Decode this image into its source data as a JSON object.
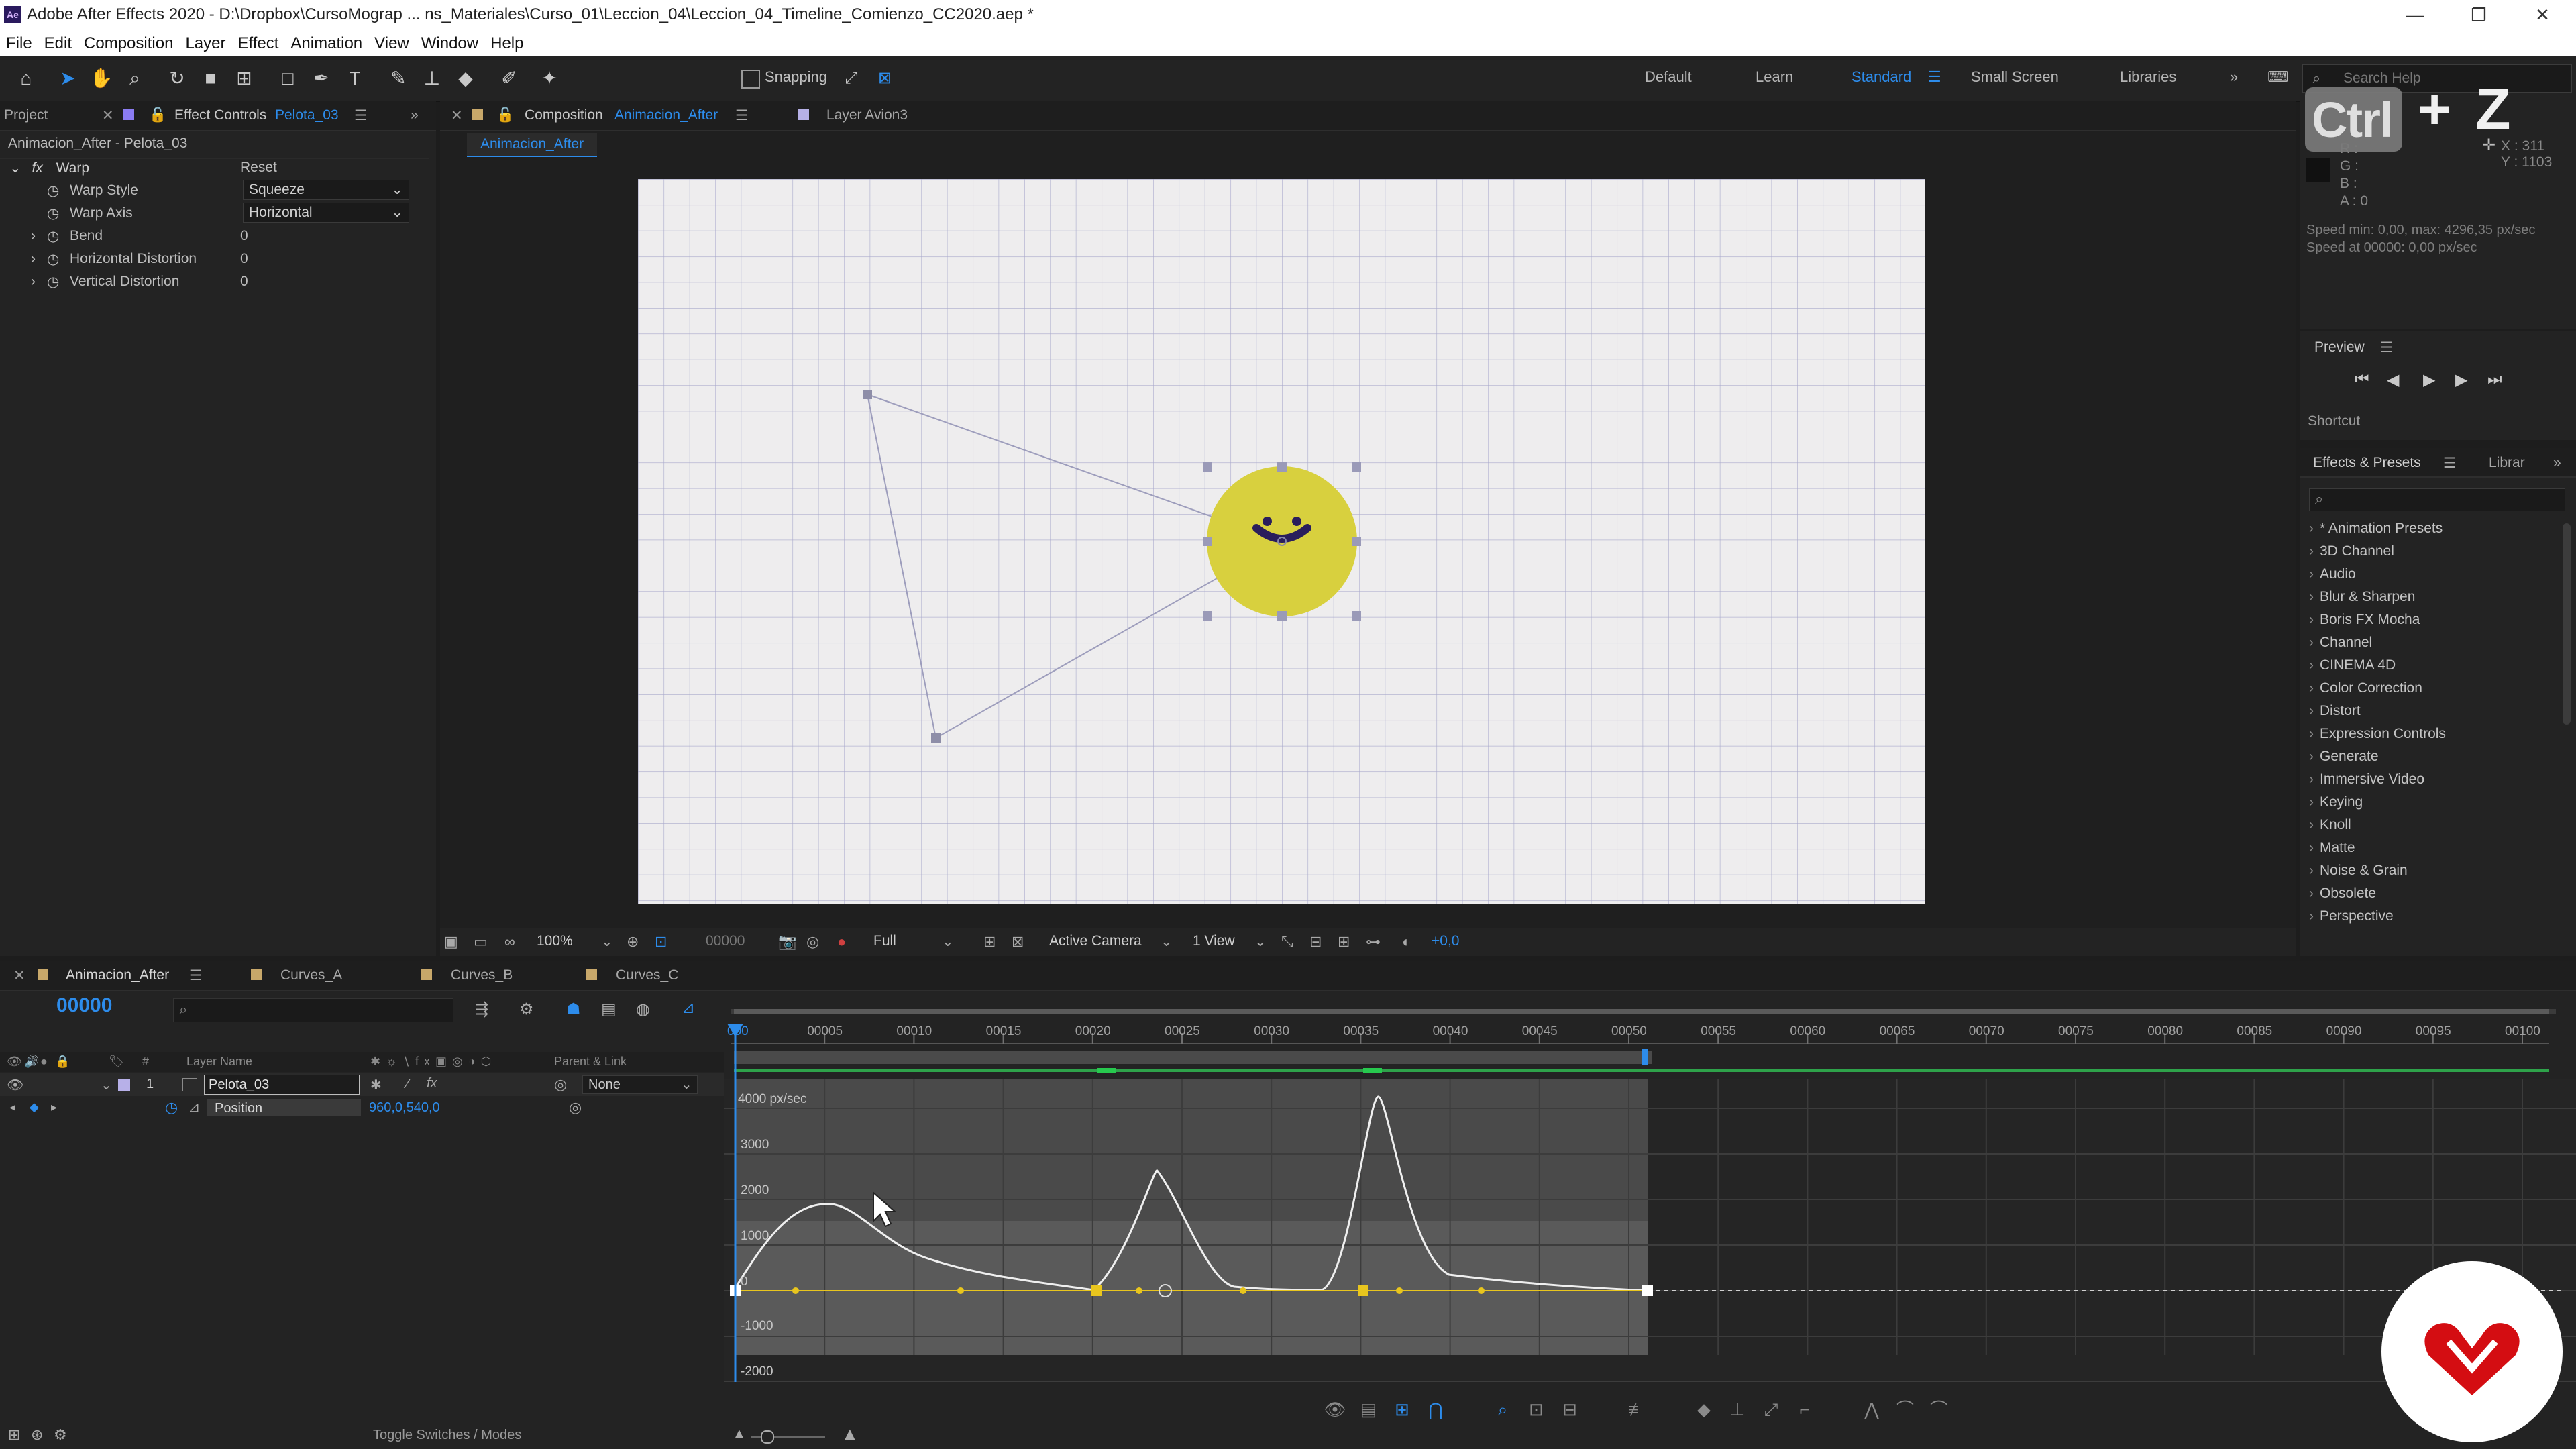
{
  "titlebar": {
    "title": "Adobe After Effects 2020 - D:\\Dropbox\\CursoMograp ... ns_Materiales\\Curso_01\\Leccion_04\\Leccion_04_Timeline_Comienzo_CC2020.aep *",
    "icon": "Ae",
    "minimize": "—",
    "maximize": "❐",
    "close": "✕"
  },
  "menu": [
    "File",
    "Edit",
    "Composition",
    "Layer",
    "Effect",
    "Animation",
    "View",
    "Window",
    "Help"
  ],
  "toolbar": {
    "snapping": "Snapping",
    "workspaces": [
      "Default",
      "Learn",
      "Standard",
      "Small Screen",
      "Libraries"
    ],
    "active_workspace": "Standard",
    "search_help": "Search Help"
  },
  "overlay": {
    "shortcut": "Ctrl + Z",
    "shortcut_key1": "Ctrl",
    "plus": "+",
    "shortcut_key2": "Z"
  },
  "info": {
    "r": "R :",
    "g": "G :",
    "b": "B :",
    "a": "A : 0",
    "x": "X : 311",
    "y": "Y : 1103",
    "speed1": "Speed min: 0,00, max: 4296,35 px/sec",
    "speed2": "Speed at 00000: 0,00 px/sec"
  },
  "preview": {
    "title": "Preview",
    "shortcut": "Shortcut"
  },
  "project_tab": "Project",
  "effect_controls": {
    "tab_label": "Effect Controls",
    "tab_layer": "Pelota_03",
    "header": "Animacion_After - Pelota_03",
    "fx_name": "Warp",
    "reset": "Reset",
    "props": [
      {
        "name": "Warp Style",
        "value": "Squeeze"
      },
      {
        "name": "Warp Axis",
        "value": "Horizontal"
      },
      {
        "name": "Bend",
        "value": "0"
      },
      {
        "name": "Horizontal Distortion",
        "value": "0"
      },
      {
        "name": "Vertical Distortion",
        "value": "0"
      }
    ]
  },
  "composition": {
    "tab_prefix": "Composition",
    "tab_name": "Animacion_After",
    "layer_tab": "Layer  Avion3",
    "breadcrumb": "Animacion_After",
    "footer": {
      "zoom": "100%",
      "timecode": "00000",
      "resolution": "Full",
      "camera": "Active Camera",
      "view": "1 View",
      "exposure": "+0,0"
    }
  },
  "effects_presets": {
    "tab": "Effects & Presets",
    "tab2": "Librar",
    "items": [
      "* Animation Presets",
      "3D Channel",
      "Audio",
      "Blur & Sharpen",
      "Boris FX Mocha",
      "Channel",
      "CINEMA 4D",
      "Color Correction",
      "Distort",
      "Expression Controls",
      "Generate",
      "Immersive Video",
      "Keying",
      "Knoll",
      "Matte",
      "Noise & Grain",
      "Obsolete",
      "Perspective"
    ]
  },
  "timeline": {
    "tabs": [
      "Animacion_After",
      "Curves_A",
      "Curves_B",
      "Curves_C"
    ],
    "timecode": "00000",
    "col_layer_name": "Layer Name",
    "col_hash": "#",
    "col_parent": "Parent & Link",
    "layer": {
      "index": "1",
      "name": "Pelota_03",
      "parent": "None"
    },
    "property": {
      "name": "Position",
      "value": "960,0,540,0"
    },
    "ruler": [
      "00005",
      "00010",
      "00015",
      "00020",
      "00025",
      "00030",
      "00035",
      "00040",
      "00045",
      "00050",
      "00055",
      "00060",
      "00065",
      "00070",
      "00075",
      "00080",
      "00085",
      "00090",
      "00095",
      "00100"
    ],
    "ruler_start": "000",
    "graph_unit_label": "4000 px/sec",
    "graph_labels": [
      "3000",
      "2000",
      "1000",
      "0",
      "-1000",
      "-2000"
    ],
    "toggle": "Toggle Switches / Modes"
  },
  "colors": {
    "accent": "#2d8ceb",
    "ball": "#d8d03e",
    "panel": "#232323",
    "keyframe": "#e8c51e"
  }
}
